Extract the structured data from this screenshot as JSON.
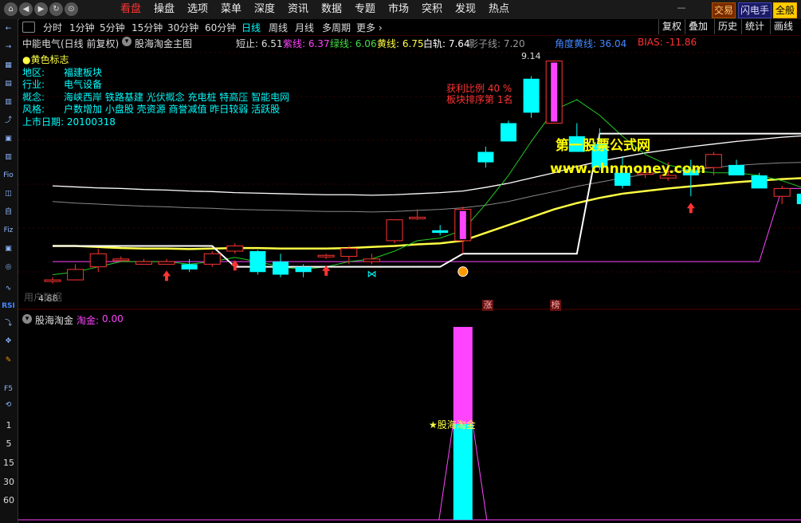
{
  "topbar": {
    "nav_icons": [
      "⌂",
      "◀",
      "▶",
      "↻",
      "⊙"
    ],
    "menus": [
      "看盘",
      "操盘",
      "选项",
      "菜单",
      "深度",
      "资讯",
      "数据",
      "专题",
      "市场",
      "突积",
      "发现",
      "热点"
    ],
    "active_menu": 0,
    "trade": "交易",
    "flash": "闪电手",
    "full": "全般"
  },
  "leftbar": {
    "icons": [
      "←",
      "→",
      "▦",
      "▤",
      "▥",
      "⤴",
      "▣",
      "▥",
      "Fio",
      "◫",
      "自",
      "Fiz",
      "▣",
      "◎",
      "∿",
      "RSI",
      "⤵",
      "✥",
      "✎",
      "F5",
      "⟲"
    ],
    "nums": [
      "1",
      "5",
      "15",
      "30",
      "60"
    ]
  },
  "periods": {
    "items": [
      "分时",
      "1分钟",
      "5分钟",
      "15分钟",
      "30分钟",
      "60分钟",
      "日线",
      "周线",
      "月线",
      "多周期",
      "更多"
    ],
    "active": 6
  },
  "right_tools": [
    "复权",
    "叠加",
    "历史",
    "统计",
    "画线"
  ],
  "main": {
    "stock_title": "中能电气(日线 前复权)",
    "indicator_title": "股海淘金主图",
    "values": [
      {
        "label": "短止:",
        "value": "6.51",
        "color": "#dddddd"
      },
      {
        "label": "紫线:",
        "value": "6.37",
        "color": "#ff44ff"
      },
      {
        "label": "绿线:",
        "value": "6.06",
        "color": "#44dd44"
      },
      {
        "label": "黄线:",
        "value": "6.75",
        "color": "#ffff44"
      },
      {
        "label": "白轨:",
        "value": "7.64",
        "color": "#ffffff"
      },
      {
        "label": "影子线:",
        "value": "7.20",
        "color": "#999999"
      },
      {
        "label": "角度黄线:",
        "value": "36.04",
        "color": "#4488ff"
      },
      {
        "label": "BIAS:",
        "value": "-11.86",
        "color": "#ff3333"
      }
    ],
    "yellow_flag": "●黄色标志",
    "region_label": "地区:",
    "region": "福建板块",
    "industry_label": "行业:",
    "industry": "电气设备",
    "concept_label": "概念:",
    "concept": "海峡西岸 铁路基建 光伏概念 充电桩 特高压 智能电网",
    "style_label": "风格:",
    "style": "户数增加 小盘股 壳资源 商誉减值 昨日较弱 活跃股",
    "listing": "上市日期: 20100318",
    "profit_ratio": "获利比例 40 %",
    "sector_rank": "板块排序第 1名",
    "watermark1": "第一股票公式网",
    "watermark2": "www.chnmoney.com",
    "high_label": "9.14",
    "low_label": "4.88",
    "ghost_text": "用户数据",
    "marker_zhang": "涨",
    "marker_bang": "榜"
  },
  "sub": {
    "title": "股海淘金",
    "value_label": "淘金:",
    "value": "0.00",
    "signal_text": "★股海淘金"
  },
  "colors": {
    "up": "#ff3333",
    "down": "#00ffff",
    "white_line": "#ffffff",
    "yellow": "#ffff44",
    "green": "#22cc22",
    "magenta": "#ff44ff",
    "gray": "#888888"
  },
  "chart_data": {
    "type": "candlestick",
    "price_range": [
      4.6,
      9.3
    ],
    "candles": [
      {
        "o": 4.95,
        "h": 5.0,
        "l": 4.88,
        "c": 4.95
      },
      {
        "o": 4.95,
        "h": 5.25,
        "l": 4.95,
        "c": 5.15
      },
      {
        "o": 5.2,
        "h": 5.55,
        "l": 5.1,
        "c": 5.45
      },
      {
        "o": 5.35,
        "h": 5.4,
        "l": 5.3,
        "c": 5.35
      },
      {
        "o": 5.25,
        "h": 5.35,
        "l": 5.25,
        "c": 5.3
      },
      {
        "o": 5.25,
        "h": 5.35,
        "l": 5.25,
        "c": 5.3
      },
      {
        "o": 5.25,
        "h": 5.35,
        "l": 5.1,
        "c": 5.15
      },
      {
        "o": 5.25,
        "h": 5.5,
        "l": 5.2,
        "c": 5.45
      },
      {
        "o": 5.5,
        "h": 5.65,
        "l": 5.45,
        "c": 5.6
      },
      {
        "o": 5.5,
        "h": 5.52,
        "l": 5.05,
        "c": 5.1
      },
      {
        "o": 5.3,
        "h": 5.45,
        "l": 5.0,
        "c": 5.05
      },
      {
        "o": 5.2,
        "h": 5.25,
        "l": 5.0,
        "c": 5.1
      },
      {
        "o": 5.4,
        "h": 5.45,
        "l": 5.35,
        "c": 5.42
      },
      {
        "o": 5.4,
        "h": 5.6,
        "l": 5.25,
        "c": 5.55
      },
      {
        "o": 5.3,
        "h": 5.45,
        "l": 5.25,
        "c": 5.35
      },
      {
        "o": 5.7,
        "h": 5.85,
        "l": 5.65,
        "c": 6.1
      },
      {
        "o": 6.15,
        "h": 6.3,
        "l": 6.1,
        "c": 6.15
      },
      {
        "o": 5.9,
        "h": 6.0,
        "l": 5.8,
        "c": 5.85
      },
      {
        "o": 5.7,
        "h": 6.35,
        "l": 5.45,
        "c": 6.3
      },
      {
        "o": 7.4,
        "h": 7.5,
        "l": 7.1,
        "c": 7.2
      },
      {
        "o": 7.95,
        "h": 8.0,
        "l": 7.6,
        "c": 7.6
      },
      {
        "o": 8.8,
        "h": 8.85,
        "l": 8.05,
        "c": 8.15
      },
      {
        "o": 7.95,
        "h": 9.14,
        "l": 7.95,
        "c": 9.14
      },
      {
        "o": 7.7,
        "h": 7.95,
        "l": 7.4,
        "c": 7.4
      },
      {
        "o": 7.55,
        "h": 7.85,
        "l": 7.05,
        "c": 7.1
      },
      {
        "o": 7.0,
        "h": 7.3,
        "l": 6.7,
        "c": 6.75
      },
      {
        "o": 7.0,
        "h": 7.1,
        "l": 6.9,
        "c": 7.0
      },
      {
        "o": 6.9,
        "h": 7.2,
        "l": 6.85,
        "c": 6.95
      },
      {
        "o": 7.05,
        "h": 7.25,
        "l": 6.55,
        "c": 6.95
      },
      {
        "o": 7.1,
        "h": 7.4,
        "l": 6.95,
        "c": 7.35
      },
      {
        "o": 7.15,
        "h": 7.25,
        "l": 6.95,
        "c": 6.95
      },
      {
        "o": 6.95,
        "h": 7.0,
        "l": 6.7,
        "c": 6.7
      },
      {
        "o": 6.55,
        "h": 6.75,
        "l": 6.4,
        "c": 6.7
      },
      {
        "o": 6.6,
        "h": 6.7,
        "l": 6.4,
        "c": 6.4
      },
      {
        "o": 6.85,
        "h": 6.9,
        "l": 6.4,
        "c": 6.45
      }
    ],
    "white_upper": [
      6.75,
      6.73,
      6.71,
      6.7,
      6.68,
      6.67,
      6.65,
      6.64,
      6.62,
      6.61,
      6.6,
      6.59,
      6.58,
      6.58,
      6.57,
      6.58,
      6.6,
      6.62,
      6.65,
      6.72,
      6.8,
      6.9,
      7.0,
      7.12,
      7.22,
      7.3,
      7.38,
      7.44,
      7.5,
      7.55,
      7.6,
      7.64,
      7.68,
      7.71,
      7.74
    ],
    "shadow_line": [
      6.45,
      6.42,
      6.4,
      6.38,
      6.36,
      6.35,
      6.33,
      6.32,
      6.3,
      6.29,
      6.28,
      6.27,
      6.26,
      6.26,
      6.25,
      6.26,
      6.28,
      6.3,
      6.33,
      6.38,
      6.45,
      6.55,
      6.64,
      6.74,
      6.82,
      6.9,
      6.97,
      7.02,
      7.06,
      7.1,
      7.14,
      7.17,
      7.19,
      7.2,
      7.2
    ],
    "yellow_line": [
      5.6,
      5.6,
      5.58,
      5.56,
      5.55,
      5.55,
      5.54,
      5.55,
      5.56,
      5.56,
      5.55,
      5.55,
      5.55,
      5.56,
      5.58,
      5.6,
      5.63,
      5.65,
      5.7,
      5.85,
      6.0,
      6.15,
      6.3,
      6.42,
      6.52,
      6.6,
      6.65,
      6.7,
      6.74,
      6.78,
      6.82,
      6.85,
      6.88,
      6.9,
      6.92
    ],
    "green_line": [
      5.05,
      5.1,
      5.2,
      5.3,
      5.3,
      5.3,
      5.25,
      5.3,
      5.38,
      5.3,
      5.2,
      5.15,
      5.2,
      5.3,
      5.35,
      5.5,
      5.7,
      5.75,
      5.9,
      6.4,
      6.95,
      7.6,
      8.2,
      8.4,
      8.1,
      7.7,
      7.35,
      7.15,
      7.05,
      7.0,
      7.0,
      6.95,
      6.85,
      6.7,
      6.5
    ],
    "white_stop": [
      5.6,
      5.6,
      5.6,
      5.6,
      5.6,
      5.6,
      5.6,
      5.6,
      5.2,
      5.2,
      5.2,
      5.2,
      5.2,
      5.2,
      5.2,
      5.2,
      5.2,
      5.2,
      5.45,
      5.45,
      5.45,
      5.45,
      5.45,
      5.45,
      7.75,
      7.75,
      7.75,
      7.75,
      7.75,
      7.75,
      7.75,
      7.75,
      7.75,
      7.75,
      7.75
    ],
    "magenta_line": [
      5.3,
      5.3,
      5.3,
      5.3,
      5.3,
      5.3,
      5.3,
      5.3,
      5.3,
      5.3,
      5.3,
      5.3,
      5.3,
      5.3,
      5.3,
      5.3,
      5.3,
      5.3,
      5.3,
      5.3,
      5.3,
      5.3,
      5.3,
      5.3,
      5.3,
      5.3,
      5.3,
      5.3,
      5.3,
      5.3,
      5.3,
      5.3,
      6.7,
      6.7,
      6.7
    ],
    "up_arrows": [
      5,
      8,
      12,
      28
    ],
    "butterflies": [
      14,
      34
    ],
    "sub_signal_index": 18
  }
}
